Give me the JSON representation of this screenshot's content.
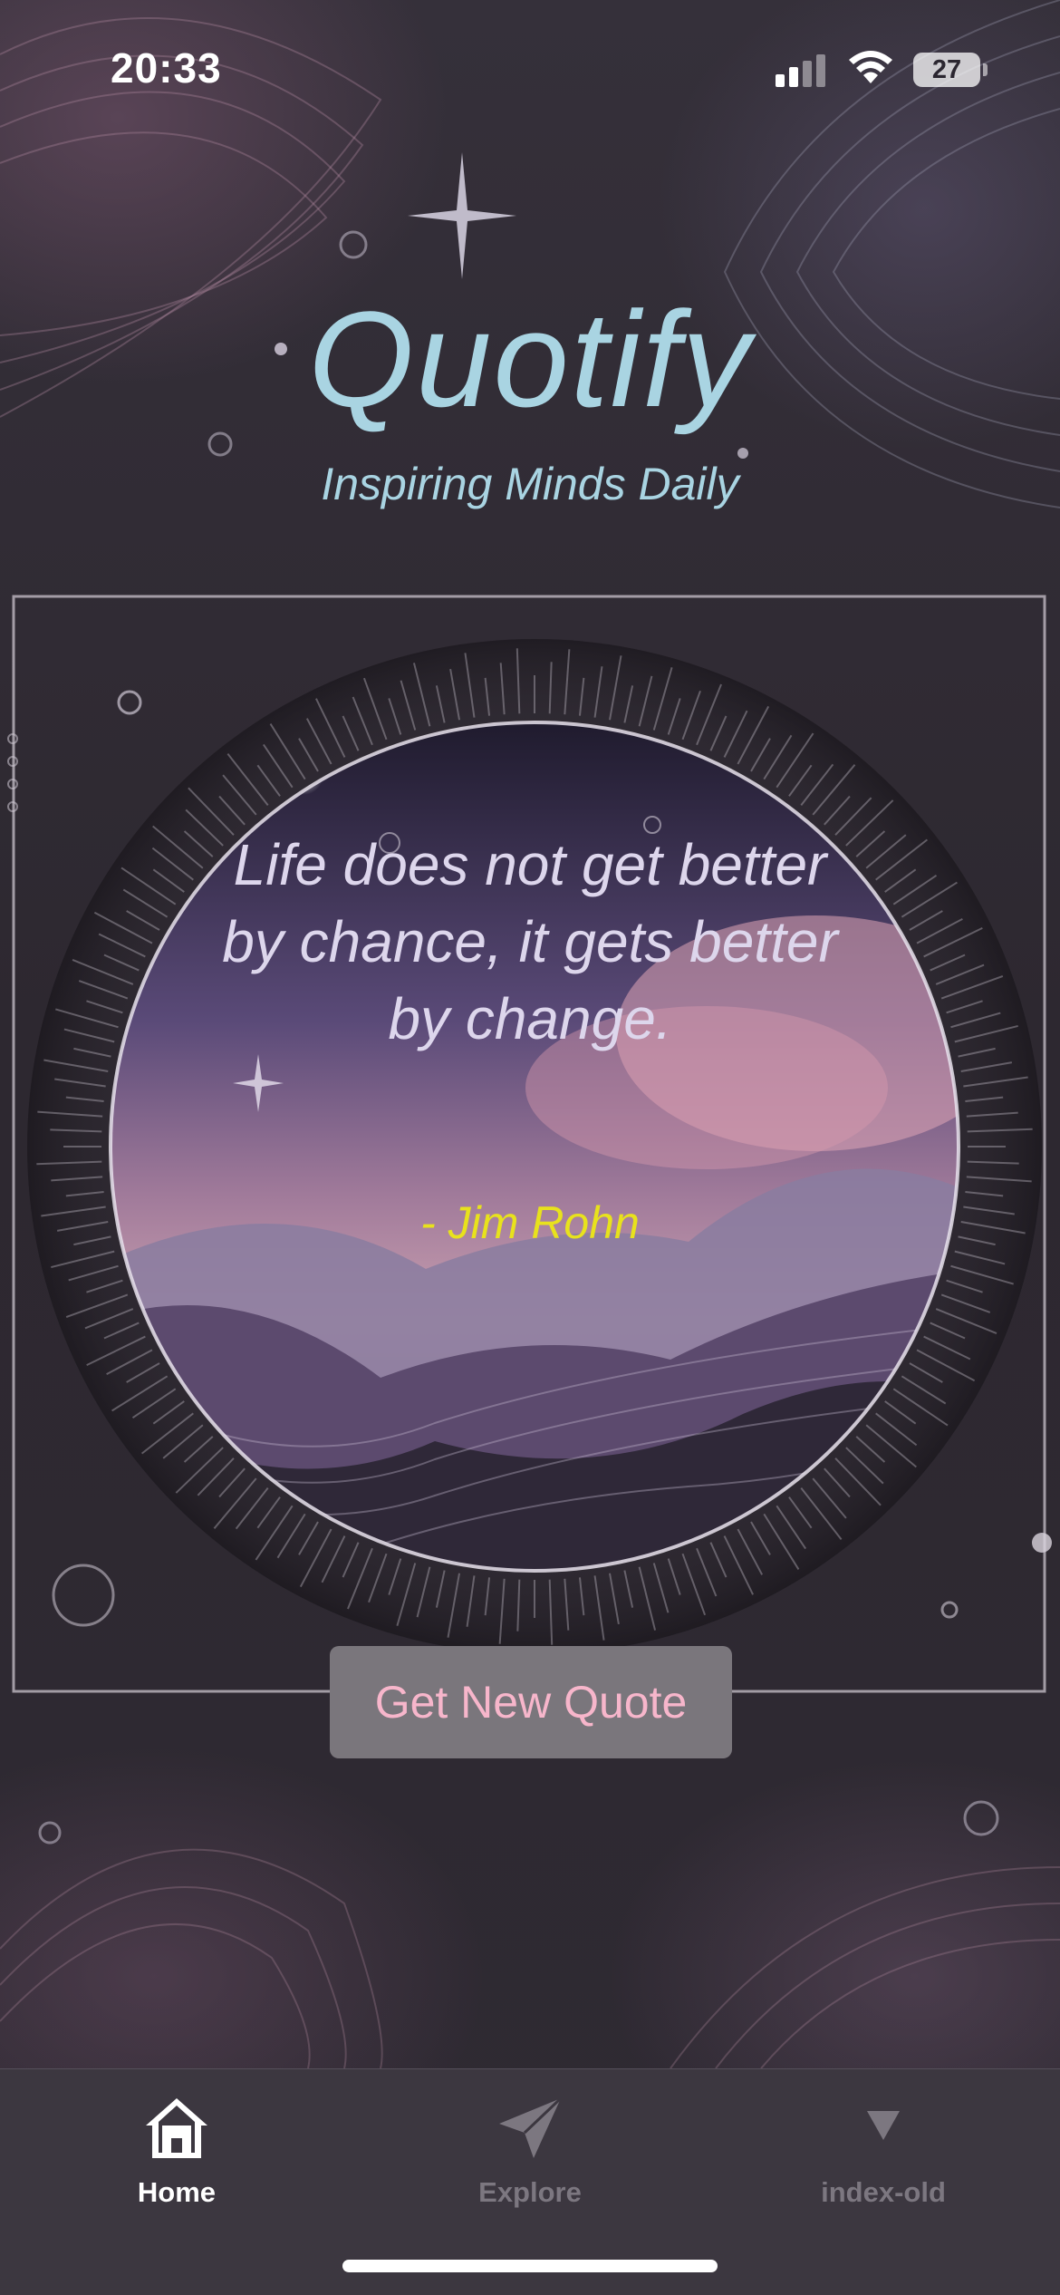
{
  "status_bar": {
    "time": "20:33",
    "battery_level": "27",
    "icons": [
      "cellular-signal-icon",
      "wifi-icon",
      "battery-icon"
    ]
  },
  "header": {
    "title": "Quotify",
    "tagline": "Inspiring Minds Daily"
  },
  "quote": {
    "text": "Life does not get better by chance, it gets better by change.",
    "author": "- Jim Rohn"
  },
  "actions": {
    "new_quote_label": "Get New Quote"
  },
  "tab_bar": {
    "tabs": [
      {
        "label": "Home",
        "icon": "home-icon",
        "active": true
      },
      {
        "label": "Explore",
        "icon": "paper-plane-icon",
        "active": false
      },
      {
        "label": "index-old",
        "icon": "triangle-down-icon",
        "active": false
      }
    ]
  },
  "colors": {
    "title": "#a9d4e2",
    "quote_text": "#ddd6ec",
    "author": "#e8e21c",
    "button_bg": "#7a767c",
    "button_text": "#f7b6cb",
    "tab_active": "#ffffff",
    "tab_inactive": "#7c7780"
  }
}
